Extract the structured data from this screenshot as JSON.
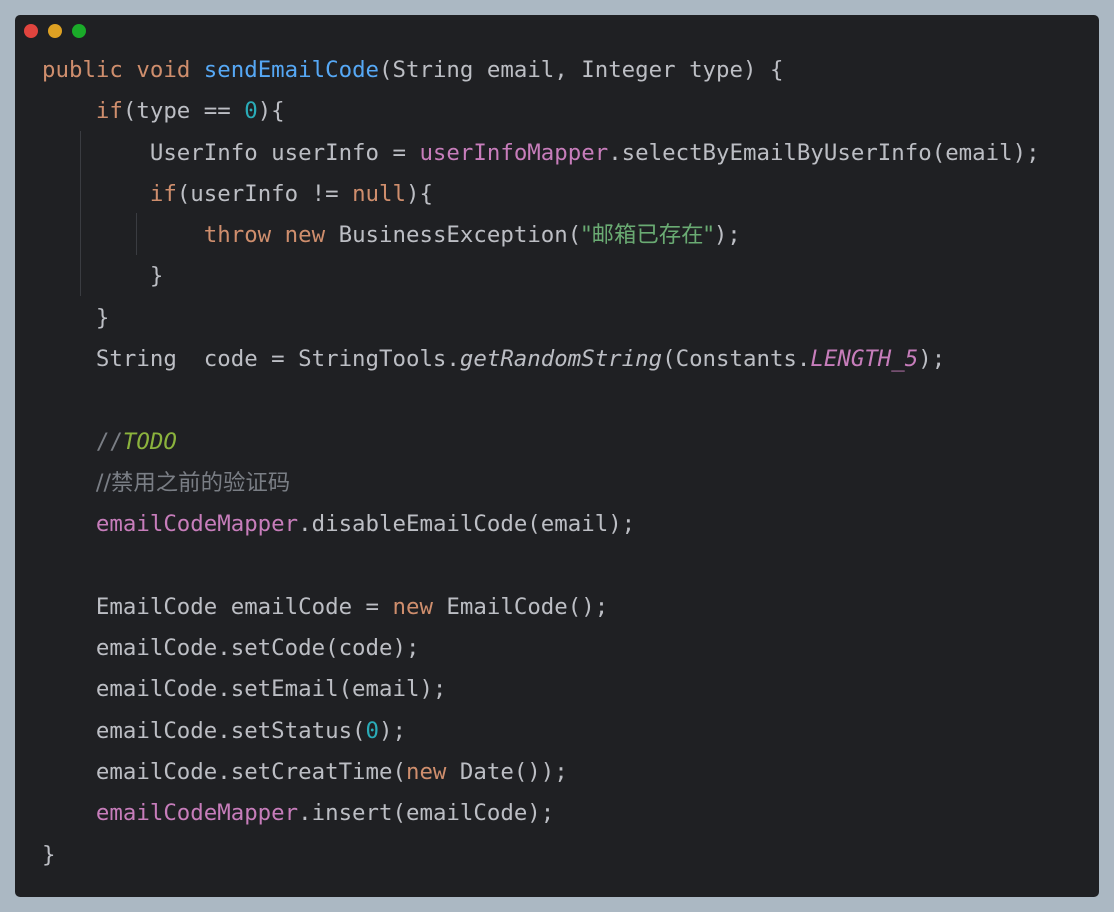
{
  "window": {
    "controls": {
      "close_color": "#e0443e",
      "minimize_color": "#dea123",
      "maximize_color": "#1aab29"
    }
  },
  "theme": {
    "background": "#1f2023",
    "text": "#bcbec4",
    "keyword": "#cf8e6d",
    "function": "#56a8f5",
    "number": "#2aacb8",
    "field": "#c77dbb",
    "string": "#6aab73",
    "comment": "#7a7e85",
    "todo": "#8bb33d"
  },
  "code": {
    "l1": [
      "public",
      " ",
      "void",
      " ",
      "sendEmailCode",
      "(String email, Integer type) {"
    ],
    "l2": [
      "    ",
      "if",
      "(type == ",
      "0",
      "){"
    ],
    "l3": [
      "        UserInfo userInfo = ",
      "userInfoMapper",
      ".selectByEmailByUserInfo(email);"
    ],
    "l4": [
      "        ",
      "if",
      "(userInfo != ",
      "null",
      "){"
    ],
    "l5": [
      "            ",
      "throw",
      " ",
      "new",
      " BusinessException(",
      "\"邮箱已存在\"",
      ");"
    ],
    "l6": "        }",
    "l7": "    }",
    "l8": [
      "    String  code = StringTools.",
      "getRandomString",
      "(Constants.",
      "LENGTH_5",
      ");"
    ],
    "l9": "",
    "l10": [
      "    ",
      "//",
      "TODO"
    ],
    "l11": [
      "    ",
      "//禁用之前的验证码"
    ],
    "l12": [
      "    ",
      "emailCodeMapper",
      ".disableEmailCode(email);"
    ],
    "l13": "",
    "l14": [
      "    EmailCode emailCode = ",
      "new",
      " EmailCode();"
    ],
    "l15": "    emailCode.setCode(code);",
    "l16": "    emailCode.setEmail(email);",
    "l17": [
      "    emailCode.setStatus(",
      "0",
      ");"
    ],
    "l18": [
      "    emailCode.setCreatTime(",
      "new",
      " Date());"
    ],
    "l19": [
      "    ",
      "emailCodeMapper",
      ".insert(emailCode);"
    ],
    "l20": "}"
  }
}
